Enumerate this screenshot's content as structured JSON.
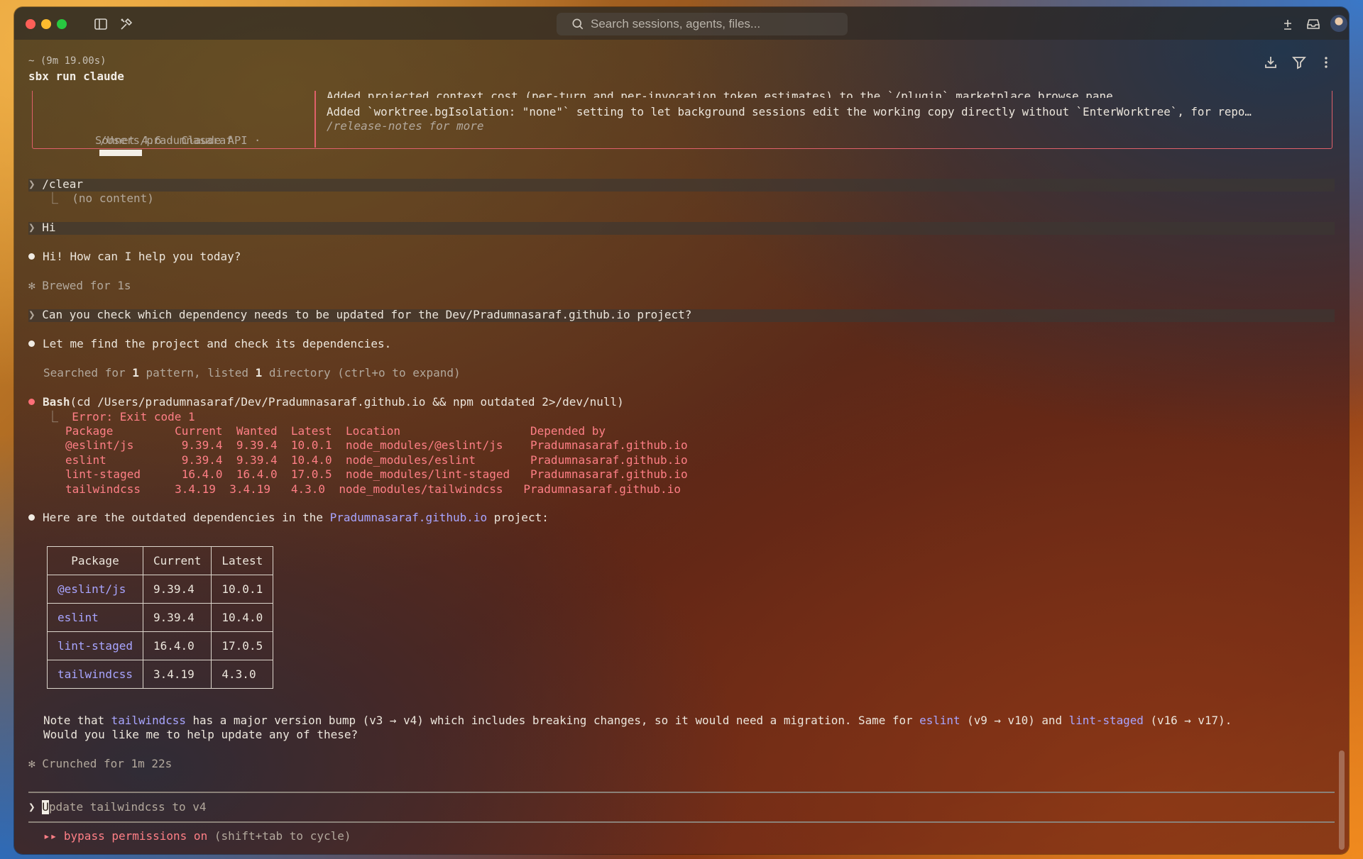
{
  "titlebar": {
    "search_placeholder": "Search sessions, agents, files...",
    "colors": {
      "close": "#fe5f57",
      "minimize": "#febc2e",
      "zoom": "#28c840"
    }
  },
  "header": {
    "path": "~ (9m 19.00s)",
    "command": "sbx run claude"
  },
  "welcome_box": {
    "model_line": "Sonnet 4.6 · Claude API ·",
    "cwd": "/Users/pradumnasaraf",
    "note_cut": "Added projected context cost (per-turn and per-invocation token estimates) to the `/plugin` marketplace browse pane",
    "note_added": "Added `worktree.bgIsolation: \"none\"` setting to let background sessions edit the working copy directly without `EnterWorktree`, for repo…",
    "release_notes": "/release-notes for more"
  },
  "transcript": {
    "prompt1": "/clear",
    "prompt1_result": "(no content)",
    "prompt2": "Hi",
    "reply1": "Hi! How can I help you today?",
    "brewed": "Brewed for 1s",
    "prompt3": "Can you check which dependency needs to be updated for the Dev/Pradumnasaraf.github.io project?",
    "reply2": "Let me find the project and check its dependencies.",
    "searched_a": "Searched for ",
    "searched_n1": "1",
    "searched_b": " pattern, listed ",
    "searched_n2": "1",
    "searched_c": " directory (ctrl+o to expand)",
    "bash_label": "Bash",
    "bash_cmd": "(cd /Users/pradumnasaraf/Dev/Pradumnasaraf.github.io && npm outdated 2>/dev/null)",
    "bash_error": "Error: Exit code 1",
    "bash_output": [
      "Package         Current  Wanted  Latest  Location                   Depended by",
      "@eslint/js       9.39.4  9.39.4  10.0.1  node_modules/@eslint/js    Pradumnasaraf.github.io",
      "eslint           9.39.4  9.39.4  10.4.0  node_modules/eslint        Pradumnasaraf.github.io",
      "lint-staged      16.4.0  16.4.0  17.0.5  node_modules/lint-staged   Pradumnasaraf.github.io",
      "tailwindcss     3.4.19  3.4.19   4.3.0  node_modules/tailwindcss   Pradumnasaraf.github.io"
    ],
    "reply3_a": "Here are the outdated dependencies in the ",
    "reply3_link": "Pradumnasaraf.github.io",
    "reply3_b": " project:",
    "table_headers": [
      "Package",
      "Current",
      "Latest"
    ],
    "table_rows": [
      [
        "@eslint/js",
        "9.39.4",
        "10.0.1"
      ],
      [
        "eslint",
        "9.39.4",
        "10.4.0"
      ],
      [
        "lint-staged",
        "16.4.0",
        "17.0.5"
      ],
      [
        "tailwindcss",
        "3.4.19",
        "4.3.0"
      ]
    ],
    "note_a": "Note that ",
    "note_link1": "tailwindcss",
    "note_b": " has a major version bump (v3 → v4) which includes breaking changes, so it would need a migration. Same for ",
    "note_link2": "eslint",
    "note_c": " (v9 → v10) and ",
    "note_link3": "lint-staged",
    "note_d": " (v16 → v17).",
    "note_line2": "Would you like me to help update any of these?",
    "crunched": "Crunched for 1m 22s"
  },
  "input": {
    "prompt_symbol": "❯",
    "cursor_char": "U",
    "text_rest": "pdate tailwindcss to v4"
  },
  "footer": {
    "arrows": "▸▸",
    "mode": "bypass permissions on",
    "hint": " (shift+tab to cycle)"
  }
}
